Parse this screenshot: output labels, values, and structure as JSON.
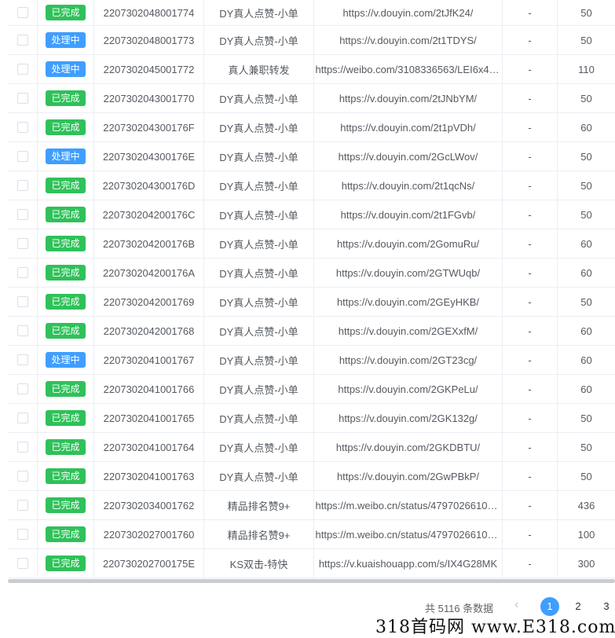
{
  "rows": [
    {
      "status": "已完成",
      "status_type": "done",
      "id": "2207302048001774",
      "type": "DY真人点赞-小单",
      "link": "https://v.douyin.com/2tJfK24/",
      "note": "-",
      "qty": "50"
    },
    {
      "status": "处理中",
      "status_type": "processing",
      "id": "2207302048001773",
      "type": "DY真人点赞-小单",
      "link": "https://v.douyin.com/2t1TDYS/",
      "note": "-",
      "qty": "50"
    },
    {
      "status": "处理中",
      "status_type": "processing",
      "id": "2207302045001772",
      "type": "真人兼职转发",
      "link": "https://weibo.com/3108336563/LEI6x44...",
      "note": "-",
      "qty": "110"
    },
    {
      "status": "已完成",
      "status_type": "done",
      "id": "2207302043001770",
      "type": "DY真人点赞-小单",
      "link": "https://v.douyin.com/2tJNbYM/",
      "note": "-",
      "qty": "50"
    },
    {
      "status": "已完成",
      "status_type": "done",
      "id": "220730204300176F",
      "type": "DY真人点赞-小单",
      "link": "https://v.douyin.com/2t1pVDh/",
      "note": "-",
      "qty": "60"
    },
    {
      "status": "处理中",
      "status_type": "processing",
      "id": "220730204300176E",
      "type": "DY真人点赞-小单",
      "link": "https://v.douyin.com/2GcLWov/",
      "note": "-",
      "qty": "50"
    },
    {
      "status": "已完成",
      "status_type": "done",
      "id": "220730204300176D",
      "type": "DY真人点赞-小单",
      "link": "https://v.douyin.com/2t1qcNs/",
      "note": "-",
      "qty": "50"
    },
    {
      "status": "已完成",
      "status_type": "done",
      "id": "220730204200176C",
      "type": "DY真人点赞-小单",
      "link": "https://v.douyin.com/2t1FGvb/",
      "note": "-",
      "qty": "50"
    },
    {
      "status": "已完成",
      "status_type": "done",
      "id": "220730204200176B",
      "type": "DY真人点赞-小单",
      "link": "https://v.douyin.com/2GomuRu/",
      "note": "-",
      "qty": "60"
    },
    {
      "status": "已完成",
      "status_type": "done",
      "id": "220730204200176A",
      "type": "DY真人点赞-小单",
      "link": "https://v.douyin.com/2GTWUqb/",
      "note": "-",
      "qty": "60"
    },
    {
      "status": "已完成",
      "status_type": "done",
      "id": "2207302042001769",
      "type": "DY真人点赞-小单",
      "link": "https://v.douyin.com/2GEyHKB/",
      "note": "-",
      "qty": "50"
    },
    {
      "status": "已完成",
      "status_type": "done",
      "id": "2207302042001768",
      "type": "DY真人点赞-小单",
      "link": "https://v.douyin.com/2GEXxfM/",
      "note": "-",
      "qty": "60"
    },
    {
      "status": "处理中",
      "status_type": "processing",
      "id": "2207302041001767",
      "type": "DY真人点赞-小单",
      "link": "https://v.douyin.com/2GT23cg/",
      "note": "-",
      "qty": "60"
    },
    {
      "status": "已完成",
      "status_type": "done",
      "id": "2207302041001766",
      "type": "DY真人点赞-小单",
      "link": "https://v.douyin.com/2GKPeLu/",
      "note": "-",
      "qty": "60"
    },
    {
      "status": "已完成",
      "status_type": "done",
      "id": "2207302041001765",
      "type": "DY真人点赞-小单",
      "link": "https://v.douyin.com/2GK132g/",
      "note": "-",
      "qty": "50"
    },
    {
      "status": "已完成",
      "status_type": "done",
      "id": "2207302041001764",
      "type": "DY真人点赞-小单",
      "link": "https://v.douyin.com/2GKDBTU/",
      "note": "-",
      "qty": "50"
    },
    {
      "status": "已完成",
      "status_type": "done",
      "id": "2207302041001763",
      "type": "DY真人点赞-小单",
      "link": "https://v.douyin.com/2GwPBkP/",
      "note": "-",
      "qty": "50"
    },
    {
      "status": "已完成",
      "status_type": "done",
      "id": "2207302034001762",
      "type": "精品排名赞9+",
      "link": "https://m.weibo.cn/status/47970266109...",
      "note": "-",
      "qty": "436"
    },
    {
      "status": "已完成",
      "status_type": "done",
      "id": "2207302027001760",
      "type": "精品排名赞9+",
      "link": "https://m.weibo.cn/status/47970266109...",
      "note": "-",
      "qty": "100"
    },
    {
      "status": "已完成",
      "status_type": "done",
      "id": "220730202700175E",
      "type": "KS双击-特快",
      "link": "https://v.kuaishouapp.com/s/IX4G28MK",
      "note": "-",
      "qty": "300"
    }
  ],
  "pagination": {
    "total": "共 5116 条数据",
    "prev_icon": "chevron-left-icon",
    "pages": [
      "1",
      "2",
      "3"
    ],
    "current_page": "1"
  },
  "watermark": "318首码网 www.E318.com",
  "colors": {
    "done": "#2fc15a",
    "processing": "#409eff",
    "active_page": "#409eff"
  }
}
